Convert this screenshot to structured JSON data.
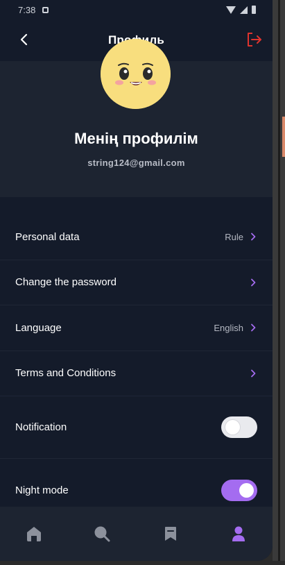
{
  "status_bar": {
    "time": "7:38"
  },
  "header": {
    "title": "Профиль",
    "back_icon": "chevron-left-icon",
    "logout_icon": "logout-icon"
  },
  "colors": {
    "background": "#141b2a",
    "card": "#1d2431",
    "accent": "#a46cf0",
    "logout": "#e0342e"
  },
  "profile": {
    "name": "Менің профилім",
    "email": "string124@gmail.com",
    "avatar_icon": "smiley-face-icon"
  },
  "settings": {
    "personal_data": {
      "label": "Personal data",
      "value": "Rule"
    },
    "change_password": {
      "label": "Change the password"
    },
    "language": {
      "label": "Language",
      "value": "English"
    },
    "terms": {
      "label": "Terms and Conditions"
    },
    "notification": {
      "label": "Notification",
      "enabled": false
    },
    "night_mode": {
      "label": "Night mode",
      "enabled": true
    }
  },
  "bottom_nav": {
    "items": [
      {
        "name": "home",
        "icon": "home-icon",
        "active": false
      },
      {
        "name": "search",
        "icon": "search-icon",
        "active": false
      },
      {
        "name": "bookmarks",
        "icon": "bookmark-icon",
        "active": false
      },
      {
        "name": "profile",
        "icon": "user-icon",
        "active": true
      }
    ]
  }
}
